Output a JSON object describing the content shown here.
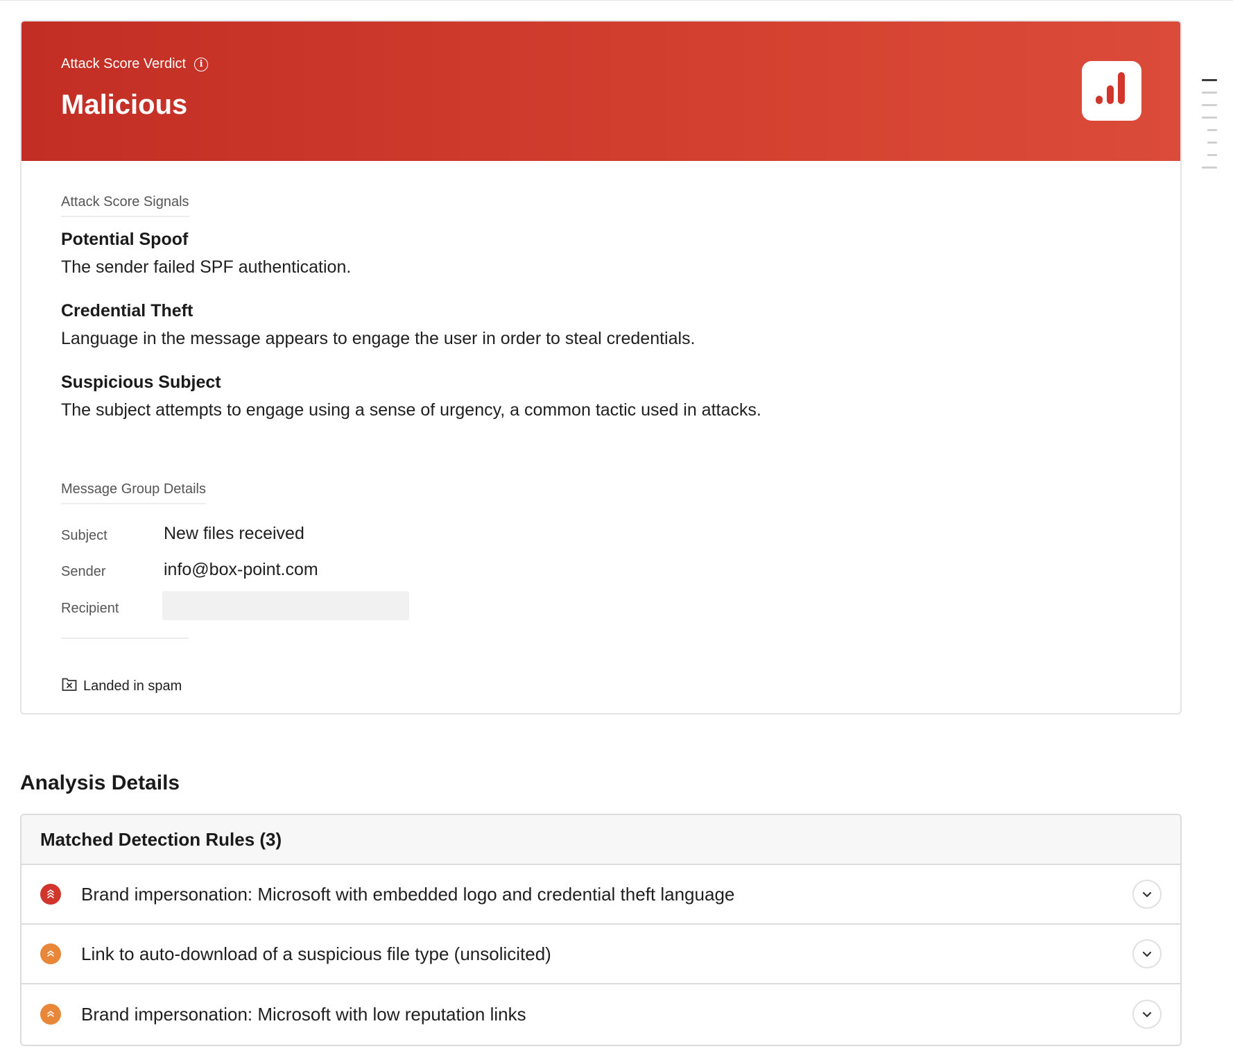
{
  "verdict": {
    "label": "Attack Score Verdict",
    "value": "Malicious",
    "banner_color": "#c9342a",
    "info_icon": "info-icon",
    "badge_icon": "bar-chart-icon"
  },
  "signals": {
    "section_label": "Attack Score Signals",
    "items": [
      {
        "title": "Potential Spoof",
        "description": "The sender failed SPF authentication."
      },
      {
        "title": "Credential Theft",
        "description": "Language in the message appears to engage the user in order to steal credentials."
      },
      {
        "title": "Suspicious Subject",
        "description": "The subject attempts to engage using a sense of urgency, a common tactic used in attacks."
      }
    ]
  },
  "message_group": {
    "section_label": "Message Group Details",
    "subject_label": "Subject",
    "subject_value": "New files received",
    "sender_label": "Sender",
    "sender_value": "info@box-point.com",
    "recipient_label": "Recipient",
    "recipient_value": "",
    "spam_status": "Landed in spam",
    "spam_icon": "spam-folder-icon"
  },
  "analysis": {
    "title": "Analysis Details",
    "rules_header": "Matched Detection Rules (3)",
    "rules": [
      {
        "label": "Brand impersonation: Microsoft with embedded logo and credential theft language",
        "severity": "high",
        "color": "#d1352b"
      },
      {
        "label": "Link to auto-download of a suspicious file type (unsolicited)",
        "severity": "medium",
        "color": "#e8873a"
      },
      {
        "label": "Brand impersonation: Microsoft with low reputation links",
        "severity": "medium",
        "color": "#e8873a"
      }
    ]
  }
}
